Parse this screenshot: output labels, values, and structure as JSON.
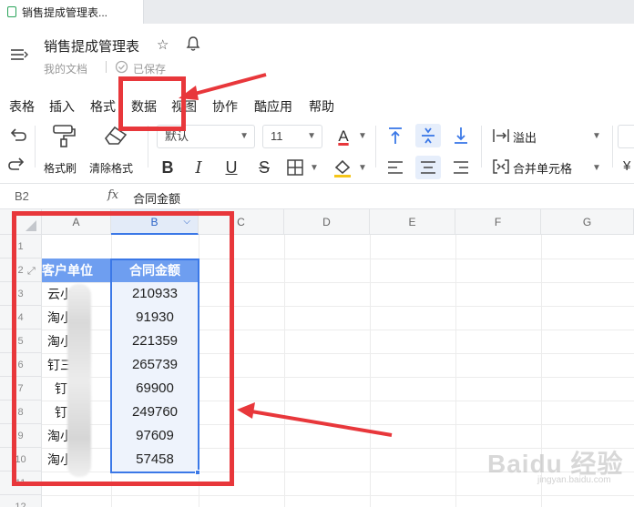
{
  "tab": {
    "title": "销售提成管理表..."
  },
  "doc": {
    "title": "销售提成管理表",
    "folder": "我的文档",
    "saved": "已保存"
  },
  "menu": [
    "表格",
    "插入",
    "格式",
    "数据",
    "视图",
    "协作",
    "酷应用",
    "帮助"
  ],
  "toolbar": {
    "format_painter": "格式刷",
    "clear_format": "清除格式",
    "font_name": "默认",
    "font_size": "11",
    "overflow": "溢出",
    "merge_cells": "合并单元格",
    "text_color": "#e8373b",
    "fill_color": "#f5c518"
  },
  "formula_bar": {
    "cell_ref": "B2",
    "fx": "fx",
    "value": "合同金额"
  },
  "columns": [
    "A",
    "B",
    "C",
    "D",
    "E",
    "F",
    "G"
  ],
  "rows": [
    "1",
    "2",
    "3",
    "4",
    "5",
    "6",
    "7",
    "8",
    "9",
    "10",
    "11",
    "12"
  ],
  "table": {
    "header_a": "客户单位",
    "header_b": "合同金额",
    "col_a": [
      "云小",
      "淘小",
      "淘小",
      "钉三",
      "钉",
      "钉",
      "淘小",
      "淘小"
    ],
    "col_b": [
      "210933",
      "91930",
      "221359",
      "265739",
      "69900",
      "249760",
      "97609",
      "57458"
    ]
  },
  "watermark": {
    "main": "Baidu 经验",
    "sub": "jingyan.baidu.com"
  },
  "colors": {
    "accent": "#3b78e7",
    "annotation": "#e8373b",
    "header_fill": "#6e9ef0"
  }
}
